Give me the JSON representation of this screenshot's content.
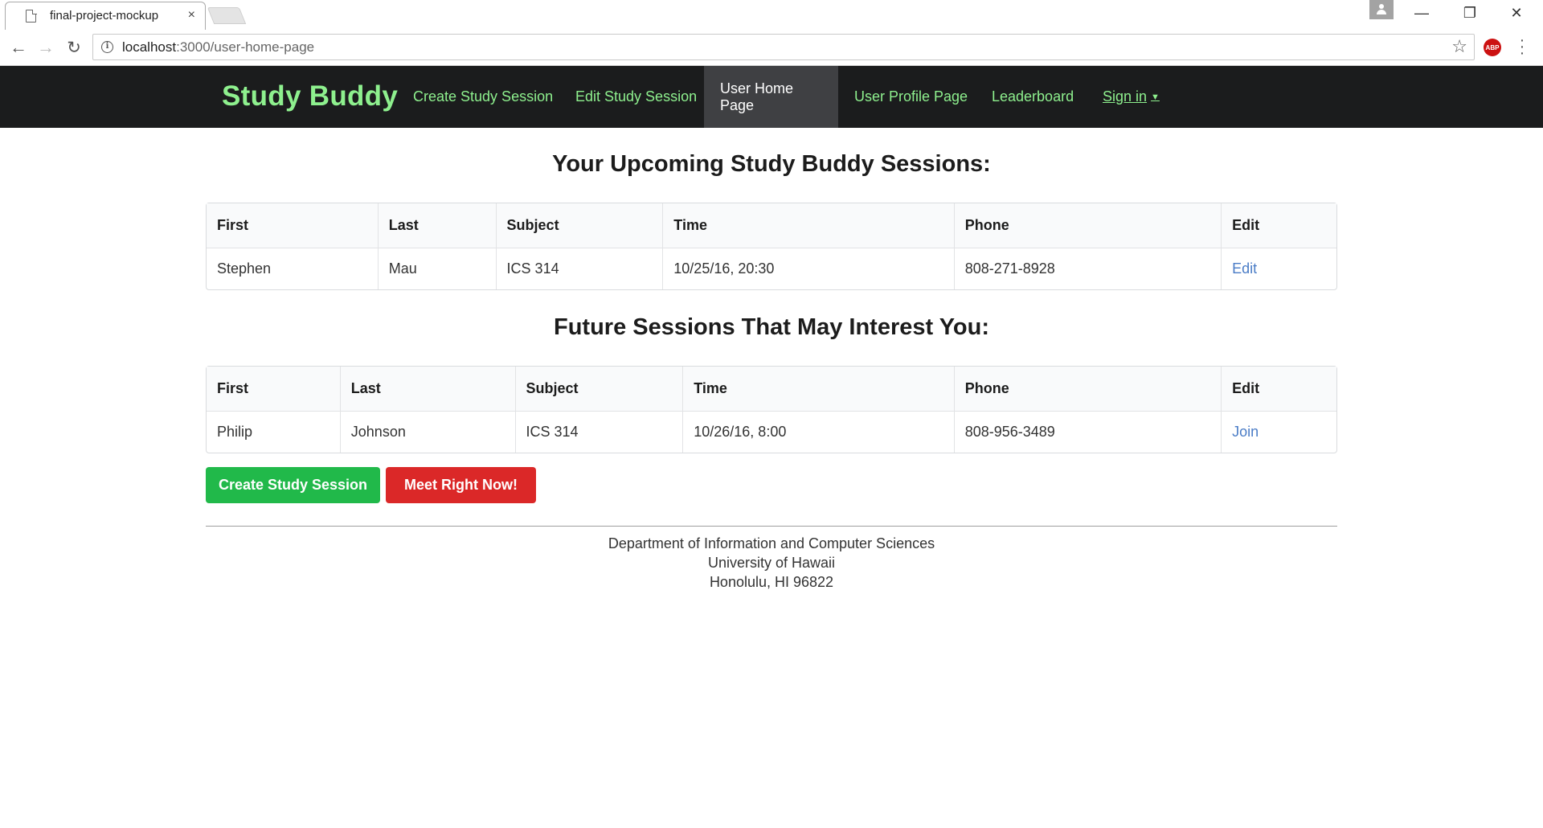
{
  "browser": {
    "tab_title": "final-project-mockup",
    "tab_close": "×",
    "url_host": "localhost",
    "url_rest": ":3000/user-home-page",
    "window_controls": [
      "—",
      "❐",
      "✕"
    ],
    "extension_label": "ABP"
  },
  "navbar": {
    "brand": "Study Buddy",
    "items": [
      {
        "label": "Create Study Session"
      },
      {
        "label": "Edit Study Session"
      },
      {
        "label": "User Home Page"
      },
      {
        "label": "User Profile Page"
      },
      {
        "label": "Leaderboard"
      },
      {
        "label": "Sign in"
      }
    ],
    "active_item": "User Home Page",
    "brand_color": "#8ef08e",
    "background_color": "#1b1c1d"
  },
  "upcoming": {
    "title": "Your Upcoming Study Buddy Sessions:",
    "headers": [
      "First",
      "Last",
      "Subject",
      "Time",
      "Phone",
      "Edit"
    ],
    "rows": [
      {
        "first": "Stephen",
        "last": "Mau",
        "subject": "ICS 314",
        "time": "10/25/16, 20:30",
        "phone": "808-271-8928",
        "action": "Edit"
      }
    ]
  },
  "future": {
    "title": "Future Sessions That May Interest You:",
    "headers": [
      "First",
      "Last",
      "Subject",
      "Time",
      "Phone",
      "Edit"
    ],
    "rows": [
      {
        "first": "Philip",
        "last": "Johnson",
        "subject": "ICS 314",
        "time": "10/26/16, 8:00",
        "phone": "808-956-3489",
        "action": "Join"
      }
    ]
  },
  "buttons": {
    "create": "Create Study Session",
    "meet": "Meet Right Now!",
    "create_color": "#21b94a",
    "meet_color": "#db2828"
  },
  "footer": {
    "line1": "Department of Information and Computer Sciences",
    "line2": "University of Hawaii",
    "line3": "Honolulu, HI 96822"
  }
}
